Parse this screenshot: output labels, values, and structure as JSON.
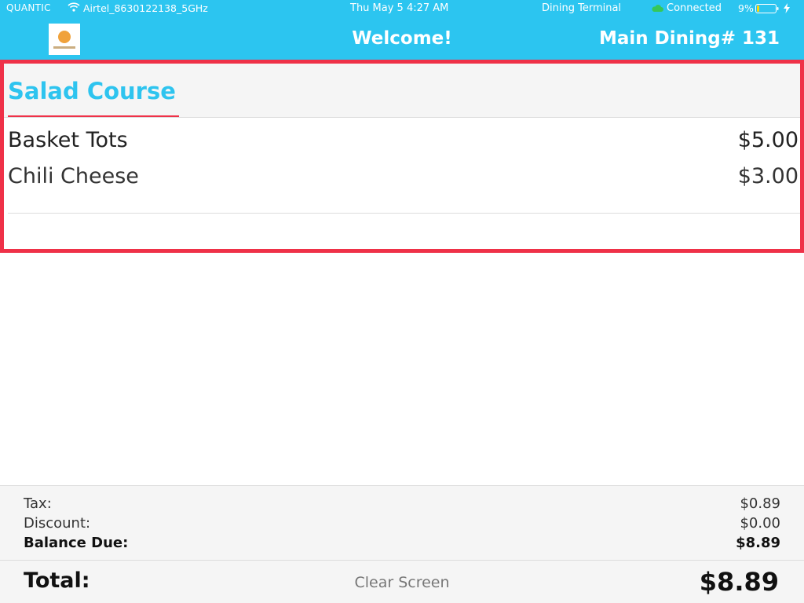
{
  "status_bar": {
    "carrier": "QUANTIC",
    "network": "Airtel_8630122138_5GHz",
    "datetime": "Thu May 5 4:27 AM",
    "terminal": "Dining Terminal",
    "connection": "Connected",
    "battery": "9%",
    "wifi_icon": "wifi-icon",
    "cloud_icon": "cloud-icon",
    "battery_icon": "battery-icon",
    "bolt_icon": "charging-bolt-icon"
  },
  "header": {
    "logo": "restaurant-logo",
    "title": "Welcome!",
    "table": "Main Dining# 131"
  },
  "order": {
    "course_title": "Salad Course",
    "items": [
      {
        "name": "Basket Tots",
        "price": "$5.00"
      },
      {
        "name": "Chili Cheese",
        "price": "$3.00"
      }
    ]
  },
  "summary": {
    "tax_label": "Tax:",
    "tax_value": "$0.89",
    "discount_label": "Discount:",
    "discount_value": "$0.00",
    "balance_label": "Balance Due:",
    "balance_value": "$8.89"
  },
  "footer": {
    "total_label": "Total:",
    "clear_label": "Clear Screen",
    "total_value": "$8.89"
  },
  "colors": {
    "header_blue": "#2cc5f0",
    "accent_red": "#ef3148",
    "course_blue": "#2ec4ef"
  }
}
